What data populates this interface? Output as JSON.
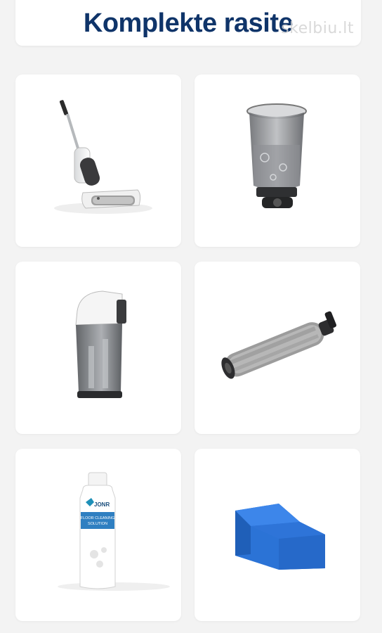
{
  "header": {
    "title": "Komplekte rasite",
    "watermark": "skelbiu.lt"
  },
  "products": [
    {
      "name": "Wet-dry vacuum mop",
      "icon": "vacuum-mop-icon"
    },
    {
      "name": "Clean water tank",
      "icon": "water-tank-icon"
    },
    {
      "name": "Dirty water tank",
      "icon": "dirty-water-tank-icon"
    },
    {
      "name": "Roller brush",
      "icon": "roller-brush-icon"
    },
    {
      "name": "Cleaning solution bottle",
      "icon": "bottle-icon",
      "labels": {
        "brand": "JONR",
        "line1": "FLOOR CLEANING",
        "line2": "SOLUTION"
      }
    },
    {
      "name": "Foam filter",
      "icon": "filter-sponge-icon"
    }
  ]
}
